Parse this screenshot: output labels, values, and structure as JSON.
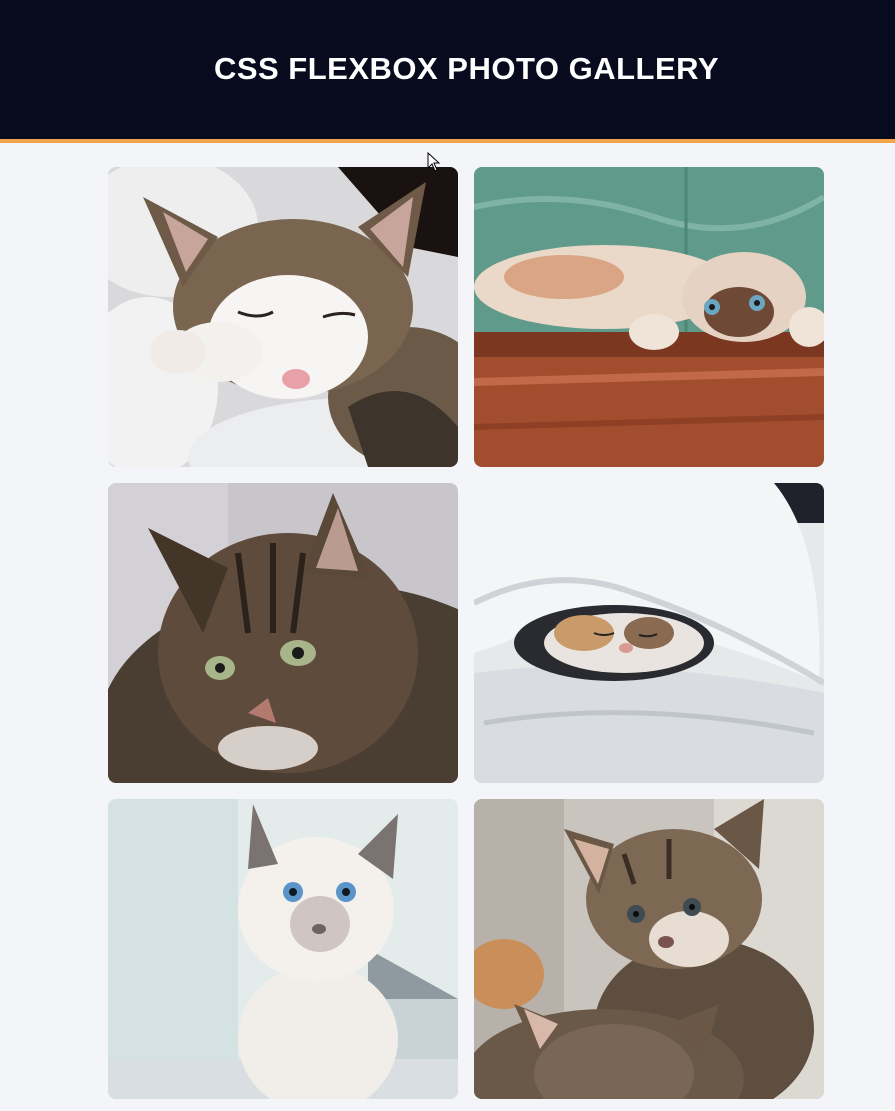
{
  "header": {
    "title": "CSS FLEXBOX PHOTO GALLERY"
  },
  "theme": {
    "header_bg": "#080a1e",
    "accent": "#f2a54a",
    "page_bg": "#f3f5f8"
  },
  "gallery": {
    "photos": [
      {
        "subject": "sleeping tabby-and-white cat on white blanket"
      },
      {
        "subject": "cream cat lying upside down on wooden floor"
      },
      {
        "subject": "long-haired brown tabby cat with green eyes"
      },
      {
        "subject": "calico cat sleeping under white duvet"
      },
      {
        "subject": "white blue-eyed kitten by window"
      },
      {
        "subject": "two tabby kittens"
      }
    ]
  }
}
